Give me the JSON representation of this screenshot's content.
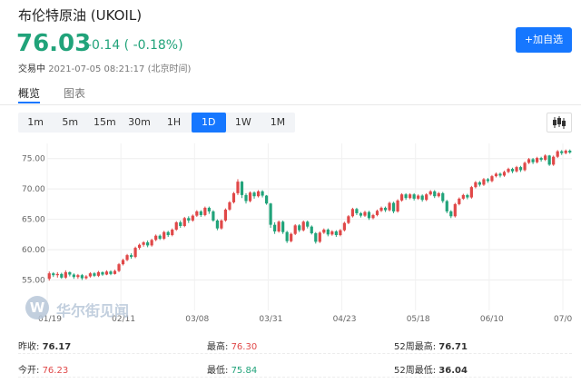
{
  "header": {
    "title": "布伦特原油 (UKOIL)",
    "price": "76.03",
    "change": "-0.14 ( -0.18%)",
    "status_label": "交易中",
    "timestamp": "2021-07-05 08:21:17 (北京时间)",
    "watch_button": "+加自选",
    "accent_color": "#1677ff",
    "up_color": "#e04848",
    "down_color": "#21a37a"
  },
  "tabs": [
    "概览",
    "图表"
  ],
  "timeframes": [
    "1m",
    "5m",
    "15m",
    "30m",
    "1H",
    "1D",
    "1W",
    "1M"
  ],
  "active_timeframe": "1D",
  "chart_type_icon": "candlestick-icon",
  "watermark": {
    "text": "华尔街见闻",
    "letter": "W"
  },
  "chart_data": {
    "type": "candlestick",
    "x_ticks": [
      "01/19",
      "02/11",
      "03/08",
      "03/31",
      "04/23",
      "05/18",
      "06/10",
      "07/0"
    ],
    "y_ticks": [
      "55.00",
      "60.00",
      "65.00",
      "70.00",
      "75.00"
    ],
    "ylim": [
      50,
      77.5
    ],
    "grid": true,
    "bars": [
      [
        55.2,
        56.1,
        54.9,
        56.4
      ],
      [
        56.1,
        55.8,
        55.5,
        56.3
      ],
      [
        55.8,
        56.0,
        55.4,
        56.3
      ],
      [
        56.0,
        55.4,
        55.2,
        56.2
      ],
      [
        55.4,
        56.3,
        55.2,
        56.6
      ],
      [
        56.3,
        55.9,
        55.6,
        56.4
      ],
      [
        55.9,
        55.5,
        55.2,
        56.1
      ],
      [
        55.5,
        55.8,
        55.2,
        56.0
      ],
      [
        55.8,
        55.3,
        55.0,
        56.0
      ],
      [
        55.3,
        55.6,
        55.1,
        55.8
      ],
      [
        55.6,
        56.1,
        55.4,
        56.3
      ],
      [
        56.1,
        55.7,
        55.5,
        56.3
      ],
      [
        55.7,
        56.3,
        55.5,
        56.5
      ],
      [
        56.3,
        55.9,
        55.7,
        56.4
      ],
      [
        55.9,
        56.4,
        55.8,
        56.6
      ],
      [
        56.4,
        56.0,
        55.8,
        56.6
      ],
      [
        56.0,
        56.5,
        55.9,
        56.7
      ],
      [
        56.5,
        57.6,
        56.3,
        57.8
      ],
      [
        57.6,
        58.3,
        57.4,
        58.5
      ],
      [
        58.3,
        59.1,
        58.1,
        59.3
      ],
      [
        59.1,
        58.8,
        58.5,
        59.4
      ],
      [
        58.8,
        60.3,
        58.6,
        60.5
      ],
      [
        60.3,
        60.8,
        60.0,
        61.0
      ],
      [
        60.8,
        61.2,
        60.5,
        61.4
      ],
      [
        61.2,
        60.7,
        60.4,
        61.5
      ],
      [
        60.7,
        61.6,
        60.5,
        61.8
      ],
      [
        61.6,
        62.3,
        61.4,
        62.5
      ],
      [
        62.3,
        61.8,
        61.6,
        62.5
      ],
      [
        61.8,
        62.9,
        61.6,
        63.1
      ],
      [
        62.9,
        62.4,
        62.1,
        63.1
      ],
      [
        62.4,
        63.3,
        62.2,
        63.5
      ],
      [
        63.3,
        64.5,
        63.1,
        64.7
      ],
      [
        64.5,
        63.9,
        63.6,
        64.8
      ],
      [
        63.9,
        65.2,
        63.7,
        65.4
      ],
      [
        65.2,
        64.8,
        64.4,
        65.5
      ],
      [
        64.8,
        65.6,
        64.6,
        65.8
      ],
      [
        65.6,
        66.3,
        65.4,
        66.5
      ],
      [
        66.3,
        65.7,
        65.4,
        66.5
      ],
      [
        65.7,
        66.9,
        65.5,
        67.1
      ],
      [
        66.9,
        66.3,
        65.9,
        67.1
      ],
      [
        66.3,
        64.8,
        64.6,
        66.5
      ],
      [
        64.8,
        63.5,
        63.2,
        65.0
      ],
      [
        63.5,
        64.8,
        63.3,
        65.0
      ],
      [
        64.8,
        66.6,
        64.6,
        66.8
      ],
      [
        66.6,
        67.8,
        66.4,
        68.0
      ],
      [
        67.8,
        69.3,
        67.6,
        69.5
      ],
      [
        69.3,
        71.2,
        69.0,
        71.6
      ],
      [
        71.2,
        69.0,
        68.5,
        71.3
      ],
      [
        69.0,
        68.0,
        67.6,
        69.3
      ],
      [
        68.0,
        69.4,
        67.8,
        69.6
      ],
      [
        69.4,
        68.8,
        68.4,
        69.6
      ],
      [
        68.8,
        69.6,
        68.6,
        69.8
      ],
      [
        69.6,
        68.9,
        68.6,
        69.8
      ],
      [
        68.9,
        67.6,
        67.4,
        69.0
      ],
      [
        67.6,
        64.1,
        63.6,
        67.7
      ],
      [
        64.1,
        63.0,
        62.6,
        64.5
      ],
      [
        63.0,
        64.6,
        62.8,
        64.8
      ],
      [
        64.6,
        62.9,
        62.6,
        64.8
      ],
      [
        62.9,
        61.4,
        61.1,
        63.1
      ],
      [
        61.4,
        62.6,
        61.2,
        62.8
      ],
      [
        62.6,
        64.0,
        62.4,
        64.2
      ],
      [
        64.0,
        63.2,
        62.9,
        64.2
      ],
      [
        63.2,
        64.6,
        63.0,
        64.8
      ],
      [
        64.6,
        63.8,
        63.5,
        64.8
      ],
      [
        63.8,
        62.7,
        62.5,
        64.0
      ],
      [
        62.7,
        61.3,
        61.0,
        62.9
      ],
      [
        61.3,
        62.8,
        61.1,
        63.0
      ],
      [
        62.8,
        63.3,
        62.6,
        63.5
      ],
      [
        63.3,
        62.5,
        62.2,
        63.5
      ],
      [
        62.5,
        63.0,
        62.3,
        63.2
      ],
      [
        63.0,
        62.4,
        62.1,
        63.2
      ],
      [
        62.4,
        63.2,
        62.2,
        63.4
      ],
      [
        63.2,
        64.4,
        63.0,
        64.6
      ],
      [
        64.4,
        65.5,
        64.2,
        65.7
      ],
      [
        65.5,
        66.7,
        65.3,
        66.9
      ],
      [
        66.7,
        66.0,
        65.7,
        66.9
      ],
      [
        66.0,
        65.6,
        65.3,
        66.2
      ],
      [
        65.6,
        66.2,
        65.4,
        66.4
      ],
      [
        66.2,
        65.2,
        64.9,
        66.4
      ],
      [
        65.2,
        65.7,
        65.0,
        65.9
      ],
      [
        65.7,
        66.4,
        65.5,
        66.6
      ],
      [
        66.4,
        66.9,
        66.2,
        67.1
      ],
      [
        66.9,
        66.5,
        66.2,
        67.1
      ],
      [
        66.5,
        67.7,
        66.3,
        67.9
      ],
      [
        67.7,
        66.3,
        66.0,
        67.9
      ],
      [
        66.3,
        68.1,
        66.1,
        68.3
      ],
      [
        68.1,
        69.1,
        67.9,
        69.3
      ],
      [
        69.1,
        68.5,
        68.2,
        69.3
      ],
      [
        68.5,
        69.1,
        68.3,
        69.3
      ],
      [
        69.1,
        68.4,
        68.1,
        69.3
      ],
      [
        68.4,
        68.9,
        68.2,
        69.1
      ],
      [
        68.9,
        68.2,
        67.9,
        69.1
      ],
      [
        68.2,
        69.1,
        68.0,
        69.3
      ],
      [
        69.1,
        69.6,
        68.9,
        69.8
      ],
      [
        69.6,
        68.8,
        68.5,
        69.8
      ],
      [
        68.8,
        69.3,
        68.6,
        69.5
      ],
      [
        69.3,
        68.0,
        67.7,
        69.5
      ],
      [
        68.0,
        66.3,
        66.0,
        68.2
      ],
      [
        66.3,
        65.5,
        65.2,
        66.5
      ],
      [
        65.5,
        67.5,
        65.3,
        67.7
      ],
      [
        67.5,
        68.4,
        67.3,
        68.6
      ],
      [
        68.4,
        69.0,
        68.2,
        69.2
      ],
      [
        69.0,
        68.6,
        68.3,
        69.2
      ],
      [
        68.6,
        70.3,
        68.4,
        70.5
      ],
      [
        70.3,
        71.1,
        70.1,
        71.3
      ],
      [
        71.1,
        70.7,
        70.4,
        71.3
      ],
      [
        70.7,
        71.6,
        70.5,
        71.8
      ],
      [
        71.6,
        71.3,
        71.0,
        71.8
      ],
      [
        71.3,
        72.1,
        71.1,
        72.3
      ],
      [
        72.1,
        72.5,
        71.9,
        72.7
      ],
      [
        72.5,
        72.2,
        71.9,
        72.7
      ],
      [
        72.2,
        72.8,
        72.0,
        73.0
      ],
      [
        72.8,
        73.3,
        72.6,
        73.5
      ],
      [
        73.3,
        72.9,
        72.6,
        73.5
      ],
      [
        72.9,
        73.6,
        72.7,
        73.8
      ],
      [
        73.6,
        73.1,
        72.8,
        73.8
      ],
      [
        73.1,
        74.3,
        72.9,
        74.5
      ],
      [
        74.3,
        74.9,
        74.1,
        75.1
      ],
      [
        74.9,
        74.4,
        74.1,
        75.1
      ],
      [
        74.4,
        75.1,
        74.2,
        75.3
      ],
      [
        75.1,
        74.8,
        74.5,
        75.3
      ],
      [
        74.8,
        75.5,
        74.6,
        75.7
      ],
      [
        75.5,
        74.0,
        73.8,
        75.6
      ],
      [
        74.0,
        75.3,
        73.8,
        75.5
      ],
      [
        75.3,
        76.2,
        75.1,
        76.4
      ],
      [
        76.2,
        75.9,
        75.6,
        76.4
      ],
      [
        75.9,
        76.3,
        75.7,
        76.5
      ],
      [
        76.3,
        76.0,
        75.8,
        76.5
      ]
    ]
  },
  "stats": {
    "prev_close_label": "昨收:",
    "prev_close": "76.17",
    "high_label": "最高:",
    "high": "76.30",
    "high52_label": "52周最高:",
    "high52": "76.71",
    "open_label": "今开:",
    "open": "76.23",
    "low_label": "最低:",
    "low": "75.84",
    "low52_label": "52周最低:",
    "low52": "36.04"
  }
}
